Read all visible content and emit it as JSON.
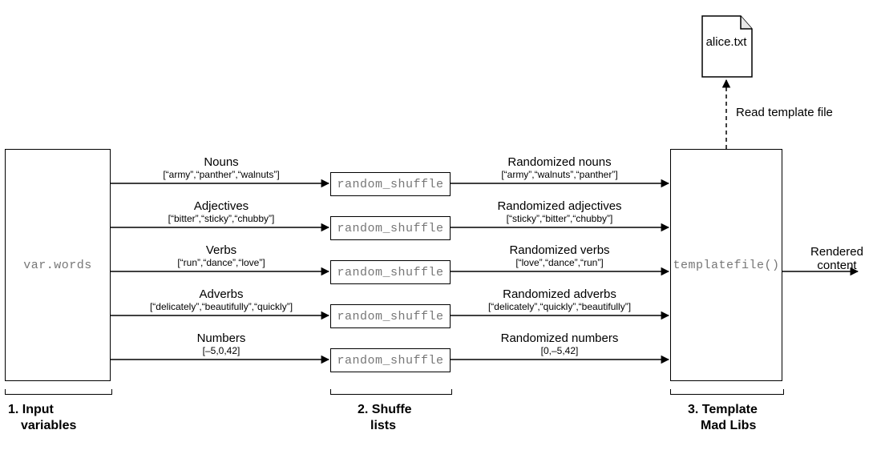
{
  "input_box": "var.words",
  "shuffle_label": "random_shuffle",
  "template_box": "templatefile()",
  "file_name": "alice.txt",
  "read_file_label": "Read template file",
  "output_label_1": "Rendered",
  "output_label_2": "content",
  "flows": {
    "nouns": {
      "left_title": "Nouns",
      "left_sub": "[“army”,“panther”,“walnuts”]",
      "right_title": "Randomized nouns",
      "right_sub": "[“army”,“walnuts”,“panther”]"
    },
    "adjectives": {
      "left_title": "Adjectives",
      "left_sub": "[“bitter”,“sticky”,“chubby”]",
      "right_title": "Randomized adjectives",
      "right_sub": "[“sticky”,“bitter”,“chubby”]"
    },
    "verbs": {
      "left_title": "Verbs",
      "left_sub": "[“run”,“dance”,“love”]",
      "right_title": "Randomized verbs",
      "right_sub": "[“love”,“dance”,“run”]"
    },
    "adverbs": {
      "left_title": "Adverbs",
      "left_sub": "[“delicately”,“beautifully”,“quickly”]",
      "right_title": "Randomized adverbs",
      "right_sub": "[“delicately”,“quickly”,“beautifully”]"
    },
    "numbers": {
      "left_title": "Numbers",
      "left_sub": "[–5,0,42]",
      "right_title": "Randomized numbers",
      "right_sub": "[0,–5,42]"
    }
  },
  "steps": {
    "s1a": "1. Input",
    "s1b": "variables",
    "s2a": "2. Shuffe",
    "s2b": "lists",
    "s3a": "3. Template",
    "s3b": "Mad Libs"
  }
}
